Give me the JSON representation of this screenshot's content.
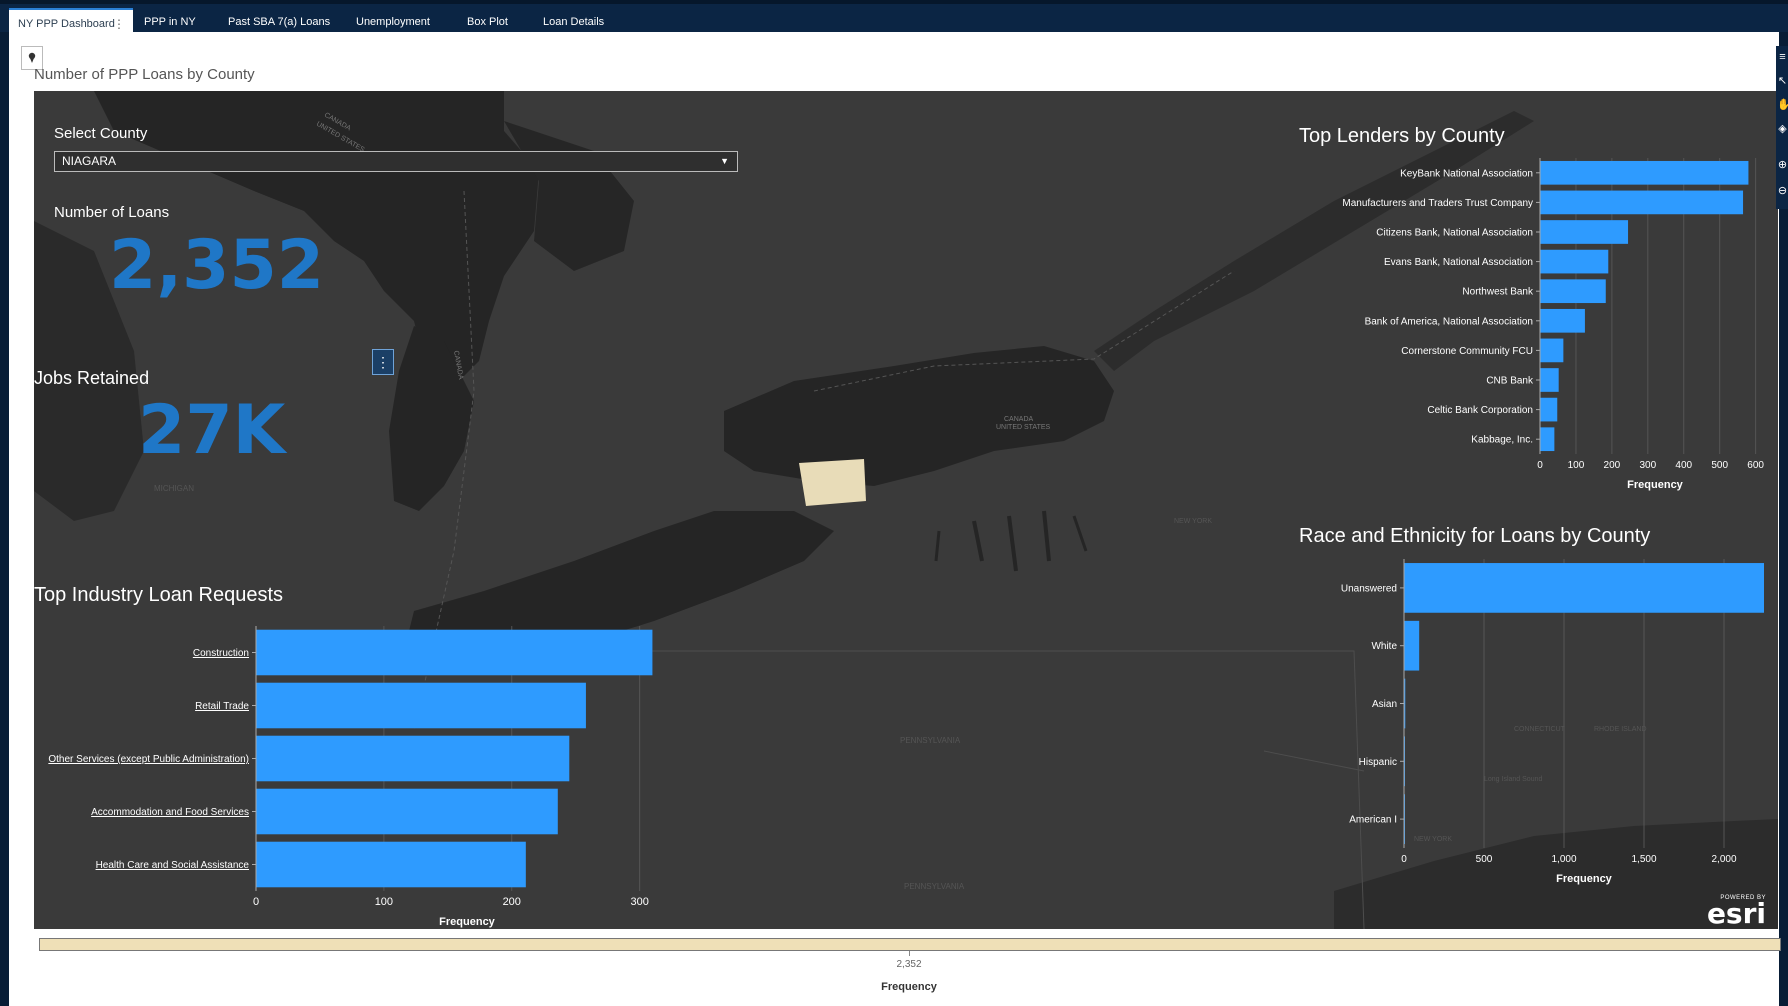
{
  "tabs": [
    {
      "label": "NY PPP Dashboard",
      "active": true
    },
    {
      "label": "PPP in NY"
    },
    {
      "label": "Past SBA 7(a) Loans"
    },
    {
      "label": "Unemployment"
    },
    {
      "label": "Box Plot"
    },
    {
      "label": "Loan Details"
    }
  ],
  "map": {
    "title": "Number of PPP Loans by County",
    "place_labels": [
      "CANADA",
      "UNITED STATES",
      "CANADA",
      "MICHIGAN",
      "CANADA",
      "UNITED STATES",
      "NEW YORK",
      "PENNSYLVANIA",
      "PENNSYLVANIA",
      "CONNECTICUT",
      "RHODE ISLAND",
      "NEW YORK",
      "Long Island Sound"
    ]
  },
  "filters": {
    "select_county_label": "Select County",
    "county_value": "NIAGARA"
  },
  "kpis": {
    "loans_label": "Number of Loans",
    "loans_value": "2,352",
    "jobs_label": "Jobs Retained",
    "jobs_value": "27K"
  },
  "colors": {
    "bar": "#2e9bff",
    "kpi": "#1f77c7",
    "highlight_county": "#e8dcb8",
    "map_land": "#3a3a3a",
    "map_water": "#252525"
  },
  "esri": {
    "powered_by": "POWERED BY",
    "logo": "esri"
  },
  "bottom_bar": {
    "value": "2,352",
    "label": "Frequency",
    "fill_fraction": 1.0
  },
  "chart_data": [
    {
      "type": "bar",
      "orientation": "horizontal",
      "title": "Top Industry Loan Requests",
      "categories": [
        "Construction",
        "Retail Trade",
        "Other Services (except Public Administration)",
        "Accommodation and Food Services",
        "Health Care and Social Assistance"
      ],
      "values": [
        310,
        258,
        245,
        236,
        211
      ],
      "xlabel": "Frequency",
      "xlim": [
        0,
        330
      ],
      "xticks": [
        0,
        100,
        200,
        300
      ],
      "xtick_labels": [
        "0",
        "100",
        "200",
        "300"
      ],
      "grid": true
    },
    {
      "type": "bar",
      "orientation": "horizontal",
      "title": "Top Lenders by County",
      "categories": [
        "KeyBank National Association",
        "Manufacturers and Traders Trust Company",
        "Citizens Bank, National Association",
        "Evans Bank, National Association",
        "Northwest Bank",
        "Bank of America, National Association",
        "Cornerstone Community FCU",
        "CNB Bank",
        "Celtic Bank Corporation",
        "Kabbage, Inc."
      ],
      "values": [
        580,
        565,
        245,
        190,
        183,
        125,
        65,
        52,
        48,
        40
      ],
      "xlabel": "Frequency",
      "xlim": [
        0,
        640
      ],
      "xticks": [
        0,
        100,
        200,
        300,
        400,
        500,
        600
      ],
      "xtick_labels": [
        "0",
        "100",
        "200",
        "300",
        "400",
        "500",
        "600"
      ],
      "grid": true
    },
    {
      "type": "bar",
      "orientation": "horizontal",
      "title": "Race and Ethnicity for Loans by County",
      "categories": [
        "Unanswered",
        "White",
        "Asian",
        "Hispanic",
        "American I"
      ],
      "values": [
        2250,
        95,
        8,
        3,
        2
      ],
      "xlabel": "Frequency",
      "xlim": [
        0,
        2250
      ],
      "xticks": [
        0,
        500,
        1000,
        1500,
        2000
      ],
      "xtick_labels": [
        "0",
        "500",
        "1,000",
        "1,500",
        "2,000"
      ],
      "grid": true
    }
  ]
}
